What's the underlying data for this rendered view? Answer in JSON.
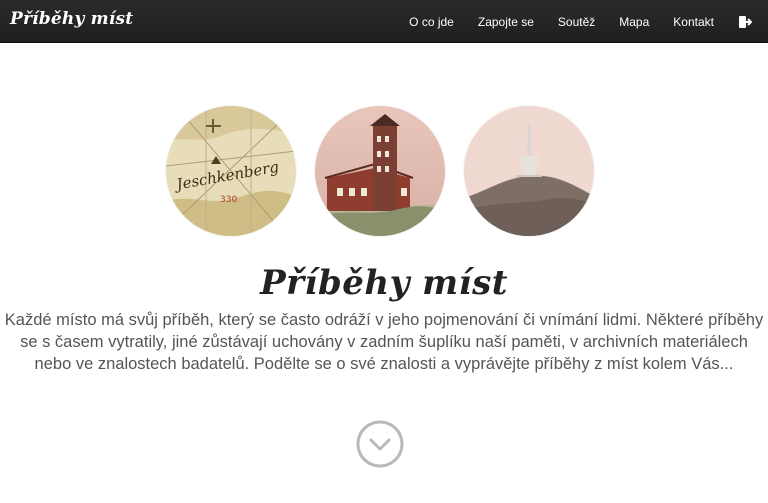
{
  "header": {
    "brand": "Příběhy míst",
    "nav": [
      {
        "label": "O co jde"
      },
      {
        "label": "Zapojte se"
      },
      {
        "label": "Soutěž"
      },
      {
        "label": "Mapa"
      },
      {
        "label": "Kontakt"
      }
    ],
    "logout_icon": "logout-icon"
  },
  "hero": {
    "title": "Příběhy míst",
    "description": "Každé místo má svůj příběh, který se často odráží v jeho pojmenování či vnímání lidmi. Některé příběhy se s časem vytratily, jiné zůstávají uchovány v zadním šuplíku naší paměti, v archivních materiálech nebo ve znalostech badatelů. Podělte se o své znalosti a vyprávějte příběhy z míst kolem Vás...",
    "images": [
      {
        "name": "old-map-image",
        "map_text": "Jeschkenberg",
        "map_number": "330"
      },
      {
        "name": "hotel-tower-image"
      },
      {
        "name": "mountain-tower-image"
      }
    ],
    "scroll_icon": "chevron-down-circle-icon"
  }
}
